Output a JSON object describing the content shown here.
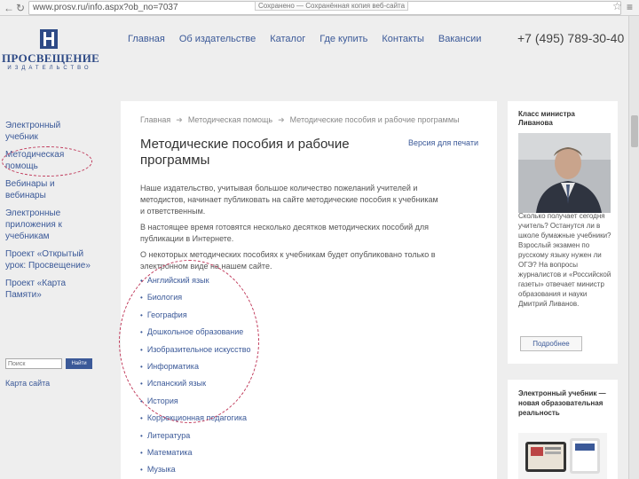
{
  "browser": {
    "url": "www.prosv.ru/info.aspx?ob_no=7037",
    "tooltip": "Сохранено — Сохранённая копия веб-сайта",
    "back_icon": "back-arrow-icon",
    "reload_icon": "reload-icon"
  },
  "logo": {
    "name": "ПРОСВЕЩЕНИЕ",
    "subtitle": "ИЗДАТЕЛЬСТВО",
    "brand_color": "#2e4a86"
  },
  "topnav": [
    "Главная",
    "Об издательстве",
    "Каталог",
    "Где купить",
    "Контакты",
    "Вакансии"
  ],
  "phone": "+7 (495) 789-30-40",
  "leftnav": [
    "Электронный учебник",
    "Методическая помощь",
    "Вебинары и вебинары",
    "Электронные приложения к учебникам",
    "Проект «Открытый урок: Просвещение»",
    "Проект «Карта Памяти»"
  ],
  "search": {
    "placeholder": "Поиск",
    "button": "Найти"
  },
  "sitemap": "Карта сайта",
  "breadcrumb": [
    "Главная",
    "Методическая помощь",
    "Методические пособия и рабочие программы"
  ],
  "page_title": "Методические пособия и рабочие программы",
  "print_link": "Версия для печати",
  "intro": [
    "Наше издательство, учитывая большое количество пожеланий учителей и методистов, начинает публиковать на сайте методические пособия к учебникам и ответственным.",
    "В настоящее время готовятся несколько десятков методических пособий для публикации в Интернете.",
    "О некоторых методических пособиях к учебникам будет опубликовано только в электронном виде на нашем сайте."
  ],
  "subjects": [
    "Английский язык",
    "Биология",
    "География",
    "Дошкольное образование",
    "Изобразительное искусство",
    "Информатика",
    "Испанский язык",
    "История",
    "Коррекционная педагогика",
    "Литература",
    "Математика",
    "Музыка"
  ],
  "right_card_1": {
    "title": "Класс министра Ливанова",
    "text": "Сколько получает сегодня учитель? Останутся ли в школе бумажные учебники? Взрослый экзамен по русскому языку нужен ли ОГЭ? На вопросы журналистов и «Российской газеты» отвечает министр образования и науки Дмитрий Ливанов.",
    "button": "Подробнее"
  },
  "right_card_2": {
    "title": "Электронный учебник — новая образовательная реальность"
  },
  "annotation_color": "#c0395a"
}
